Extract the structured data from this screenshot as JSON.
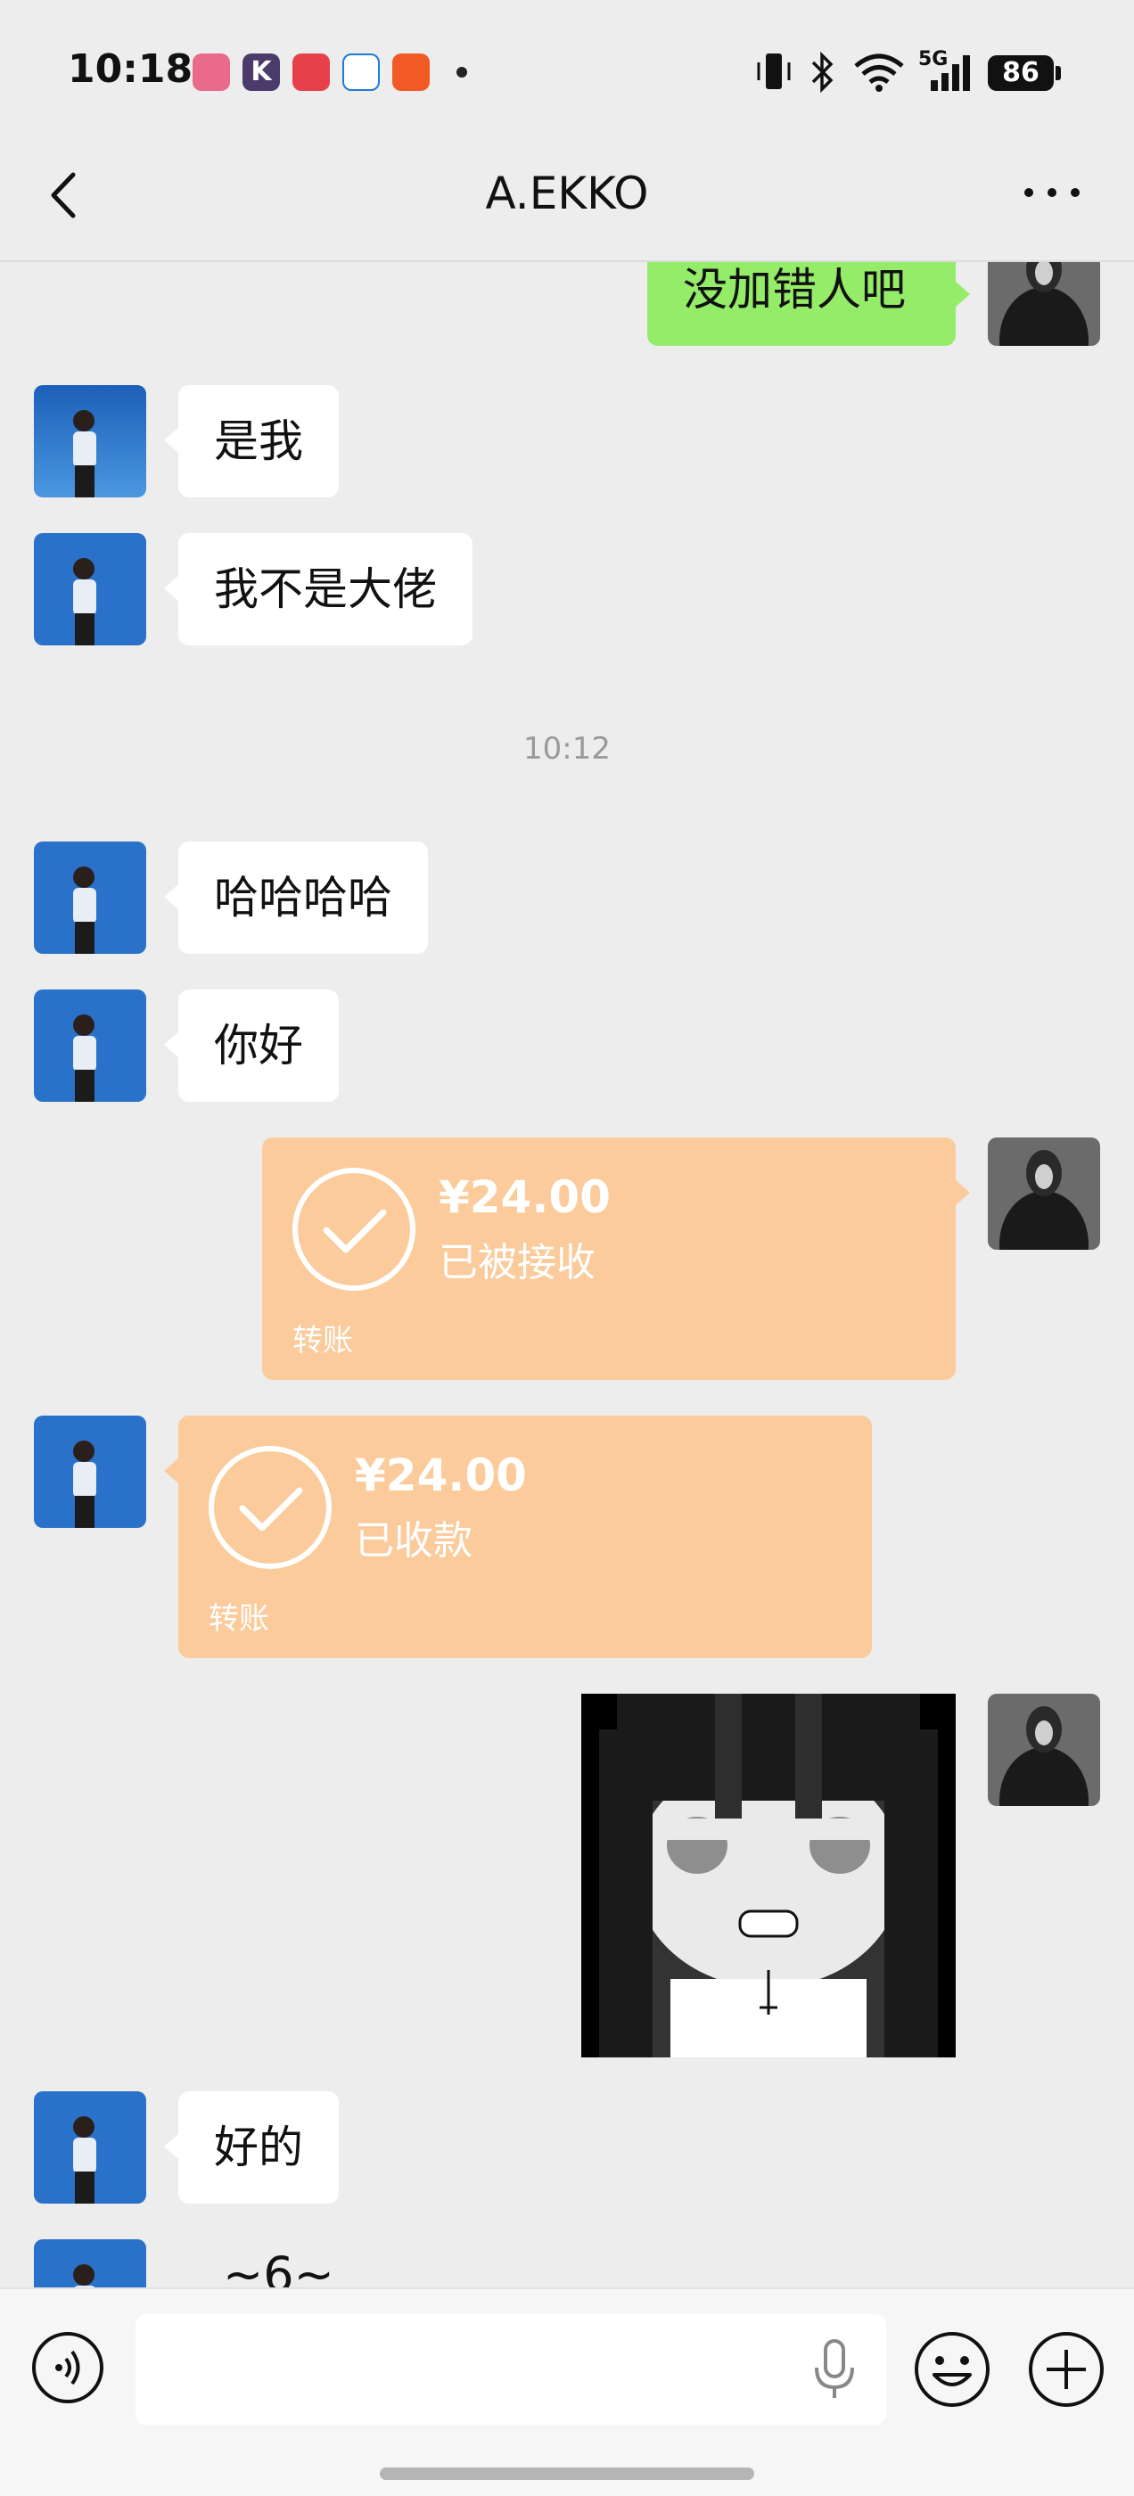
{
  "status_bar": {
    "time": "10:18",
    "battery": "86",
    "network": "5G"
  },
  "header": {
    "title": "A.EKKO"
  },
  "messages": {
    "m1": "没加错人吧",
    "m2": "是我",
    "m3": "我不是大佬",
    "time_sep": "10:12",
    "m4": "哈哈哈哈",
    "m5": "你好",
    "transfer_out": {
      "amount": "¥24.00",
      "status": "已被接收",
      "label": "转账"
    },
    "transfer_in": {
      "amount": "¥24.00",
      "status": "已收款",
      "label": "转账"
    },
    "m6": "好的",
    "m7": "~6~"
  },
  "colors": {
    "background": "#ededed",
    "outgoing_bubble": "#95ec69",
    "incoming_bubble": "#ffffff",
    "transfer_bubble": "#fbcb9c"
  },
  "input": {
    "value": "",
    "placeholder": ""
  },
  "icons": [
    "back-arrow-icon",
    "more-dots-icon",
    "voice-icon",
    "microphone-icon",
    "emoji-icon",
    "plus-icon"
  ]
}
